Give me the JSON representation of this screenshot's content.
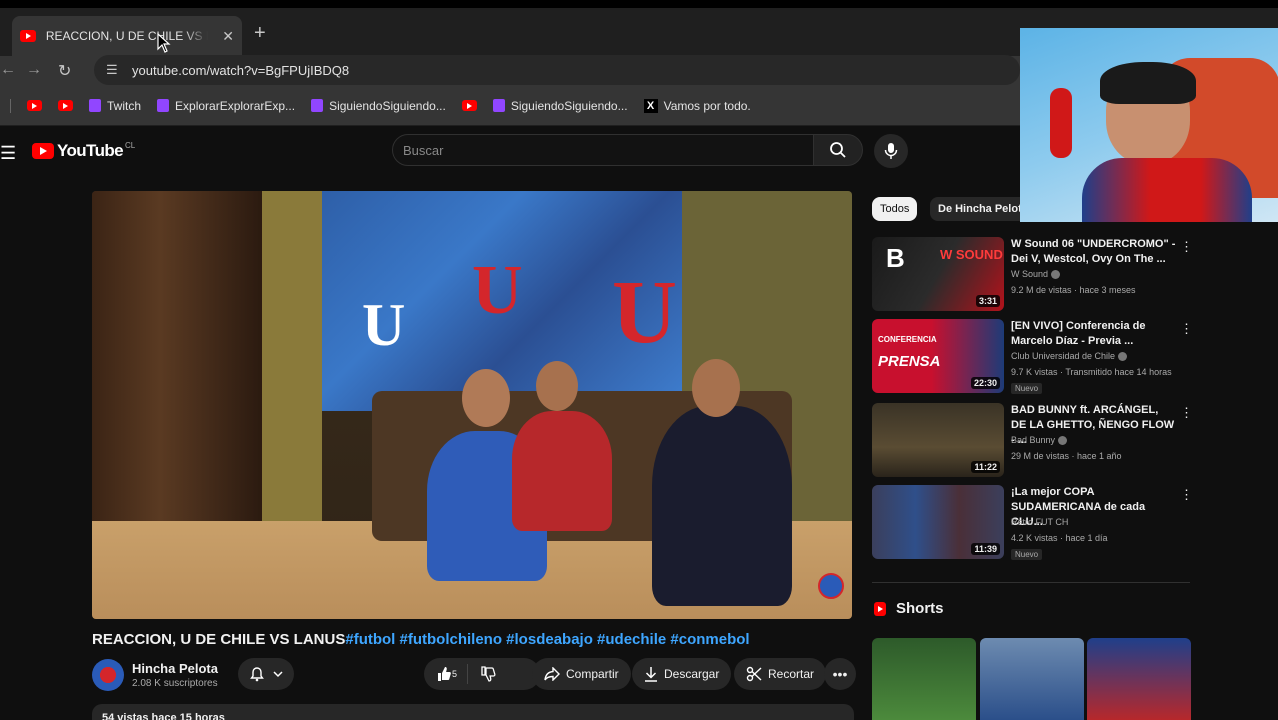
{
  "browser": {
    "tab_title": "REACCION, U DE CHILE VS LANUS",
    "url": "youtube.com/watch?v=BgFPUjIBDQ8",
    "bookmarks": [
      {
        "label": "",
        "icon": "youtube-icon"
      },
      {
        "label": "",
        "icon": "youtube-icon"
      },
      {
        "label": "Twitch",
        "icon": "twitch-icon"
      },
      {
        "label": "ExplorarExplorarExp...",
        "icon": "twitch-icon"
      },
      {
        "label": "SiguiendoSiguiendo...",
        "icon": "twitch-icon"
      },
      {
        "label": "",
        "icon": "youtube-icon"
      },
      {
        "label": "SiguiendoSiguiendo...",
        "icon": "twitch-icon"
      },
      {
        "label": "Vamos por todo.",
        "icon": "x-icon"
      }
    ]
  },
  "youtube": {
    "logo_text": "YouTube",
    "country_code": "CL",
    "search_placeholder": "Buscar",
    "video": {
      "title": "REACCION, U DE CHILE VS LANUS",
      "hashtags": "#futbol #futbolchileno #losdeabajo #udechile #conmebol",
      "channel": "Hincha Pelota",
      "subscribers": "2.08 K suscriptores",
      "likes": "5",
      "share_label": "Compartir",
      "download_label": "Descargar",
      "clip_label": "Recortar",
      "views_line": "54 vistas  hace 15 horas"
    },
    "chips": [
      "Todos",
      "De Hincha Pelota"
    ],
    "recommendations": [
      {
        "title": "W Sound 06 \"UNDERCROMO\" - Dei V, Westcol, Ovy On The ...",
        "channel": "W Sound",
        "meta": "9.2 M de vistas · hace 3 meses",
        "duration": "3:31",
        "badge": ""
      },
      {
        "title": "[EN VIVO] Conferencia de Marcelo Díaz - Previa ...",
        "channel": "Club Universidad de Chile",
        "meta": "9.7 K vistas · Transmitido hace 14 horas",
        "duration": "22:30",
        "badge": "Nuevo"
      },
      {
        "title": "BAD BUNNY ft. ARCÁNGEL, DE LA GHETTO, ÑENGO FLOW - ...",
        "channel": "Bad Bunny",
        "meta": "29 M de vistas · hace 1 año",
        "duration": "11:22",
        "badge": ""
      },
      {
        "title": "¡La mejor COPA SUDAMERICANA de cada CLU...",
        "channel": "Retro FUT CH",
        "meta": "4.2 K vistas · hace 1 día",
        "duration": "11:39",
        "badge": "Nuevo"
      }
    ],
    "shorts_label": "Shorts"
  },
  "colors": {
    "brand_red": "#ff0000",
    "link_blue": "#3ea6ff",
    "bg": "#0f0f0f"
  }
}
